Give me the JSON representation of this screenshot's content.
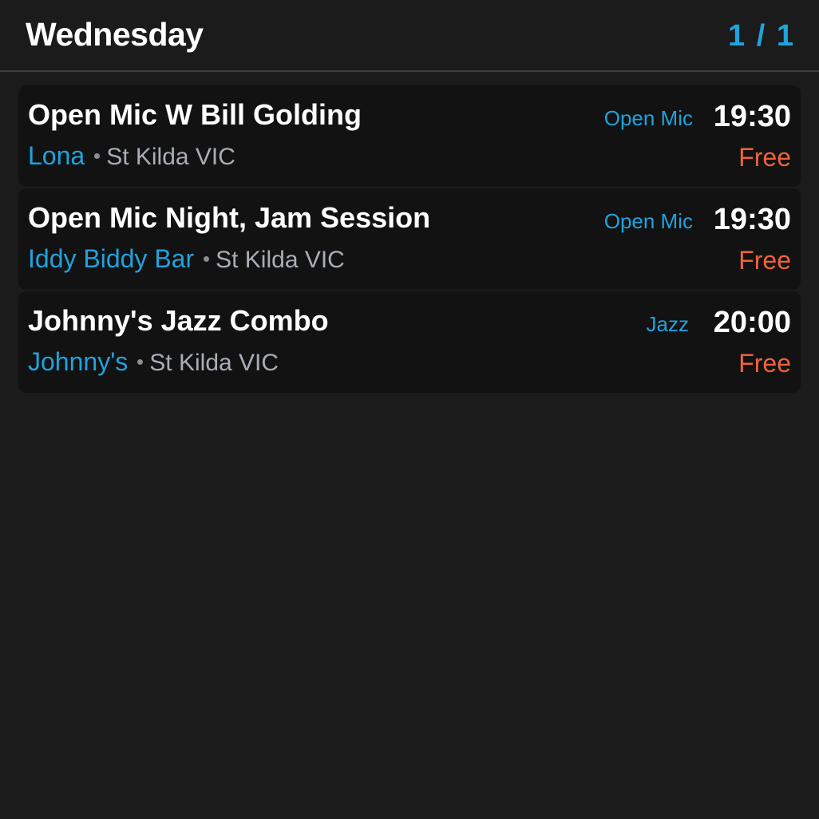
{
  "colors": {
    "accent": "#1fa3dd",
    "price": "#f0623d",
    "background": "#1b1b1b",
    "card": "#121212",
    "muted": "#a9adb6"
  },
  "header": {
    "title": "Wednesday",
    "page_indicator": "1 / 1"
  },
  "events": [
    {
      "title": "Open Mic W Bill Golding",
      "venue": "Lona",
      "location": "St Kilda VIC",
      "genre": "Open Mic",
      "time": "19:30",
      "price": "Free"
    },
    {
      "title": "Open Mic Night, Jam Session",
      "venue": "Iddy Biddy Bar",
      "location": "St Kilda VIC",
      "genre": "Open Mic",
      "time": "19:30",
      "price": "Free"
    },
    {
      "title": "Johnny's Jazz Combo",
      "venue": "Johnny's",
      "location": "St Kilda VIC",
      "genre": "Jazz",
      "time": "20:00",
      "price": "Free"
    }
  ]
}
